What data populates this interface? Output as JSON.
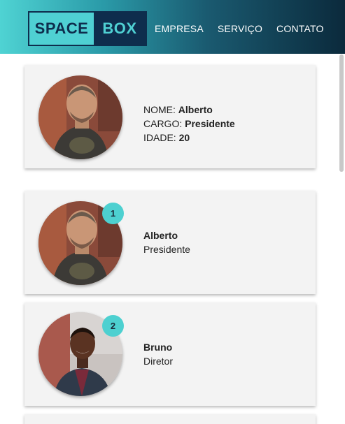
{
  "header": {
    "logo_left": "SPACE",
    "logo_right": "BOX",
    "nav": [
      "EMPRESA",
      "SERVIÇO",
      "CONTATO"
    ]
  },
  "profile": {
    "name_label": "NOME:",
    "name_value": "Alberto",
    "role_label": "CARGO:",
    "role_value": "Presidente",
    "age_label": "IDADE:",
    "age_value": "20"
  },
  "members": [
    {
      "rank": "1",
      "name": "Alberto",
      "role": "Presidente"
    },
    {
      "rank": "2",
      "name": "Bruno",
      "role": "Diretor"
    }
  ],
  "colors": {
    "accent": "#4dd0d0",
    "brand_dark": "#0e2d4d"
  }
}
